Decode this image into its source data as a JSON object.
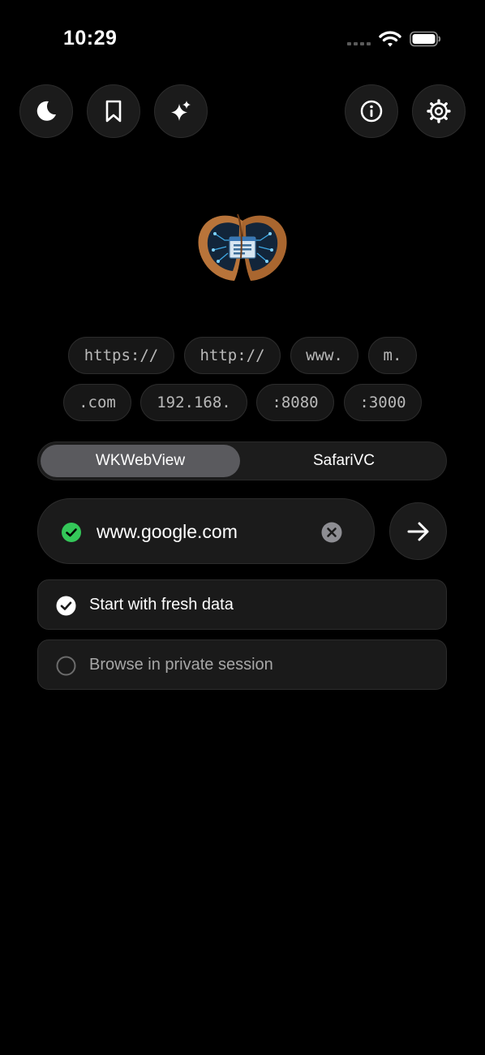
{
  "status_bar": {
    "time": "10:29",
    "icons": [
      "cellular-signal-icon",
      "wifi-icon",
      "battery-icon"
    ]
  },
  "toolbar": {
    "left_buttons": [
      "moon-icon",
      "bookmark-icon",
      "sparkles-icon"
    ],
    "right_buttons": [
      "info-icon",
      "gear-icon"
    ]
  },
  "logo": {
    "icon": "walnut-browser-logo"
  },
  "quick_inserts": {
    "row1": [
      "https://",
      "http://",
      "www.",
      "m."
    ],
    "row2": [
      ".com",
      "192.168.",
      ":8080",
      ":3000"
    ]
  },
  "engine_selector": {
    "options": [
      "WKWebView",
      "SafariVC"
    ],
    "selected": "WKWebView"
  },
  "url_bar": {
    "value": "www.google.com",
    "valid_icon": "checkmark-circle-icon",
    "clear_icon": "clear-circle-icon",
    "go_icon": "arrow-right-icon"
  },
  "options": {
    "fresh_data": {
      "label": "Start with fresh data",
      "checked": true
    },
    "private_session": {
      "label": "Browse in private session",
      "checked": false
    }
  },
  "colors": {
    "background": "#000000",
    "accent_green": "#34c759",
    "segment_active": "#5a5a5e"
  }
}
